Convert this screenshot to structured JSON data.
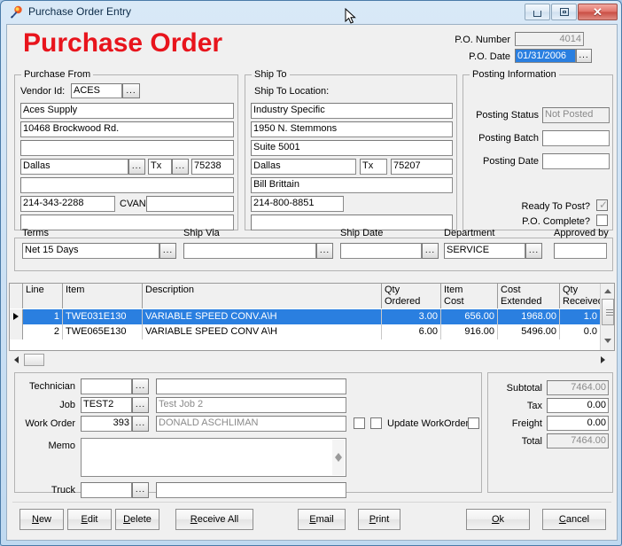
{
  "window": {
    "title": "Purchase Order Entry",
    "icon": "app-icon",
    "controls": {
      "minimize": "minimize",
      "maximize": "maximize",
      "close": "close"
    }
  },
  "header": {
    "page_title": "Purchase Order",
    "po_number_label": "P.O. Number",
    "po_number_value": "4014",
    "po_date_label": "P.O. Date",
    "po_date_value": "01/31/2006",
    "ellipsis": "..."
  },
  "purchase_from": {
    "legend": "Purchase From",
    "vendor_id_label": "Vendor Id:",
    "vendor_id_value": "ACES",
    "name": "Aces Supply",
    "address1": "10468 Brockwood Rd.",
    "address2": "",
    "city": "Dallas",
    "state": "Tx",
    "zip": "75238",
    "country": "",
    "phone": "214-343-2288",
    "cvan_label": "CVAN",
    "cvan_value": "",
    "extra": ""
  },
  "ship_to": {
    "legend": "Ship To",
    "location_label": "Ship To Location:",
    "name": "Industry Specific",
    "address1": "1950 N. Stemmons",
    "address2": "Suite 5001",
    "city": "Dallas",
    "state": "Tx",
    "zip": "75207",
    "contact": "Bill Brittain",
    "phone": "214-800-8851",
    "extra": ""
  },
  "posting": {
    "legend": "Posting Information",
    "status_label": "Posting Status",
    "status_value": "Not Posted",
    "batch_label": "Posting Batch",
    "batch_value": "",
    "date_label": "Posting Date",
    "date_value": "",
    "ready_label": "Ready To Post?",
    "ready_checked": true,
    "complete_label": "P.O. Complete?",
    "complete_checked": false
  },
  "terms_row": {
    "terms_label": "Terms",
    "terms_value": "Net 15 Days",
    "ship_via_label": "Ship Via",
    "ship_via_value": "",
    "ship_date_label": "Ship Date",
    "ship_date_value": "",
    "department_label": "Department",
    "department_value": "SERVICE",
    "approved_by_label": "Approved by",
    "approved_by_value": ""
  },
  "grid": {
    "columns": [
      "Line",
      "Item",
      "Description",
      "Qty\nOrdered",
      "Item\nCost",
      "Cost\nExtended",
      "Qty\nReceived"
    ],
    "columns_display": {
      "line": "Line",
      "item": "Item",
      "description": "Description",
      "qty_ordered_1": "Qty",
      "qty_ordered_2": "Ordered",
      "item_cost_1": "Item",
      "item_cost_2": "Cost",
      "cost_ext_1": "Cost",
      "cost_ext_2": "Extended",
      "qty_recv_1": "Qty",
      "qty_recv_2": "Received"
    },
    "rows": [
      {
        "line": "1",
        "item": "TWE031E130",
        "description": "VARIABLE SPEED CONV.A\\H",
        "qty_ordered": "3.00",
        "item_cost": "656.00",
        "cost_extended": "1968.00",
        "qty_received": "1.0",
        "selected": true
      },
      {
        "line": "2",
        "item": "TWE065E130",
        "description": "VARIABLE SPEED CONV A\\H",
        "qty_ordered": "6.00",
        "item_cost": "916.00",
        "cost_extended": "5496.00",
        "qty_received": "0.0",
        "selected": false
      }
    ]
  },
  "detail": {
    "technician_label": "Technician",
    "technician_code": "",
    "technician_name": "",
    "job_label": "Job",
    "job_code": "TEST2",
    "job_name": "Test Job 2",
    "work_order_label": "Work Order",
    "work_order_code": "393",
    "work_order_name": "DONALD ASCHLIMAN",
    "update_workorder_label": "Update WorkOrder",
    "memo_label": "Memo",
    "memo_value": "",
    "truck_label": "Truck",
    "truck_code": "",
    "truck_name": ""
  },
  "totals": {
    "subtotal_label": "Subtotal",
    "subtotal_value": "7464.00",
    "tax_label": "Tax",
    "tax_value": "0.00",
    "freight_label": "Freight",
    "freight_value": "0.00",
    "total_label": "Total",
    "total_value": "7464.00"
  },
  "buttons": {
    "new": {
      "pre": "",
      "key": "N",
      "post": "ew"
    },
    "edit": {
      "pre": "",
      "key": "E",
      "post": "dit"
    },
    "delete": {
      "pre": "",
      "key": "D",
      "post": "elete"
    },
    "receive_all": {
      "pre": "",
      "key": "R",
      "post": "eceive All"
    },
    "email": {
      "pre": "",
      "key": "E",
      "post": "mail"
    },
    "print": {
      "pre": "",
      "key": "P",
      "post": "rint"
    },
    "ok": {
      "pre": "",
      "key": "O",
      "post": "k"
    },
    "cancel": {
      "pre": "",
      "key": "C",
      "post": "ancel"
    }
  },
  "colors": {
    "title_red": "#e8141c",
    "selection_blue": "#2a7fe0",
    "face": "#f0f0f0"
  }
}
